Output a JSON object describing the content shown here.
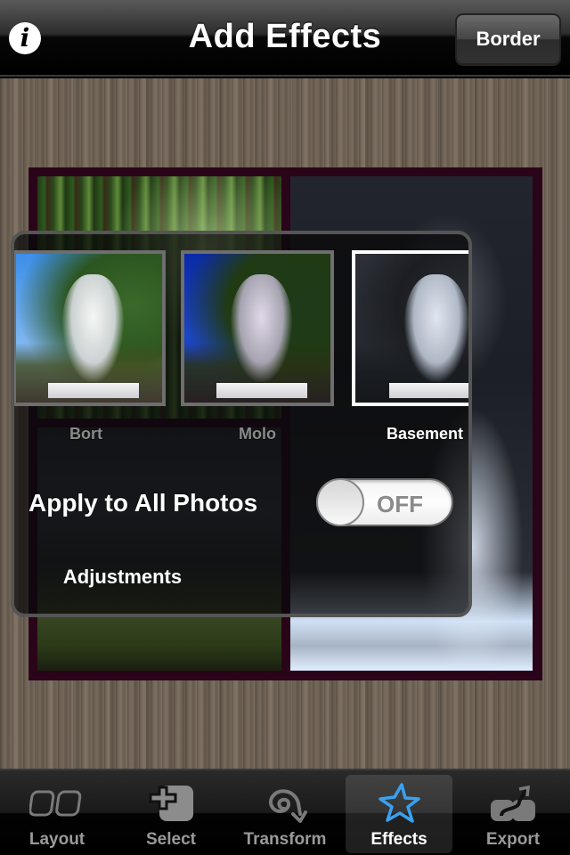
{
  "navbar": {
    "title": "Add Effects",
    "info_icon_glyph": "i",
    "border_button_label": "Border"
  },
  "effects_panel": {
    "thumbnails": [
      {
        "label": "Bort",
        "selected": false
      },
      {
        "label": "Molo",
        "selected": false
      },
      {
        "label": "Basement",
        "selected": true
      }
    ],
    "apply_all_label": "Apply to All Photos",
    "apply_all_toggle": {
      "state": "OFF"
    },
    "adjustments_button_label": "Adjustments"
  },
  "collage": {
    "border_color": "#2a0519"
  },
  "tabbar": {
    "tabs": [
      {
        "label": "Layout",
        "icon": "layout-icon",
        "active": false
      },
      {
        "label": "Select",
        "icon": "select-photo-icon",
        "active": false
      },
      {
        "label": "Transform",
        "icon": "transform-icon",
        "active": false
      },
      {
        "label": "Effects",
        "icon": "star-icon",
        "active": true
      },
      {
        "label": "Export",
        "icon": "export-icon",
        "active": false
      }
    ],
    "active_color": "#3aa0f0"
  }
}
